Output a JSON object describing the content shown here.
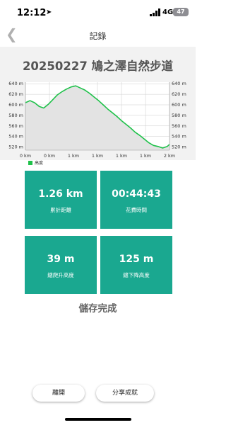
{
  "status_bar": {
    "time": "12:12",
    "location_icon": "location-arrow-icon",
    "network": "4G",
    "battery": "47"
  },
  "nav": {
    "back_icon": "chevron-left-icon",
    "title": "記錄"
  },
  "route": {
    "title": "20250227 鳩之澤自然步道"
  },
  "chart_data": {
    "type": "area",
    "title": "",
    "xlabel": "",
    "ylabel": "",
    "legend": [
      "高度"
    ],
    "legend_position": "bottom-left",
    "color": "#1fc14a",
    "y_ticks": [
      "640 m",
      "620 m",
      "600 m",
      "580 m",
      "560 m",
      "540 m",
      "520 m"
    ],
    "y_tick_values": [
      640,
      620,
      600,
      580,
      560,
      540,
      520
    ],
    "x_tick_labels": [
      "0 km",
      "0 km",
      "1 km",
      "1 km",
      "1 km",
      "1 km",
      "2 km"
    ],
    "ylim": [
      514,
      643
    ],
    "grid": true,
    "series": [
      {
        "x": [
          0,
          0.04,
          0.08,
          0.12,
          0.16,
          0.2,
          0.24,
          0.28,
          0.32,
          0.36,
          0.4,
          0.44,
          0.48,
          0.52,
          0.56,
          0.6,
          0.64,
          0.68,
          0.72,
          0.76,
          0.8,
          0.84,
          0.88,
          0.92,
          0.96,
          1.0,
          1.04,
          1.08,
          1.12,
          1.16,
          1.2,
          1.24,
          1.26
        ],
        "values": [
          604,
          608,
          604,
          597,
          594,
          601,
          610,
          619,
          625,
          630,
          634,
          636,
          632,
          628,
          622,
          615,
          608,
          600,
          592,
          585,
          578,
          570,
          563,
          556,
          548,
          542,
          535,
          528,
          523,
          521,
          518,
          521,
          525
        ]
      }
    ]
  },
  "stats": [
    {
      "value": "1.26 km",
      "label": "累計距離"
    },
    {
      "value": "00:44:43",
      "label": "花費時間"
    },
    {
      "value": "39 m",
      "label": "總爬升高度"
    },
    {
      "value": "125 m",
      "label": "總下降高度"
    }
  ],
  "status": {
    "message": "儲存完成"
  },
  "actions": {
    "leave": "離開",
    "share": "分享成就"
  }
}
